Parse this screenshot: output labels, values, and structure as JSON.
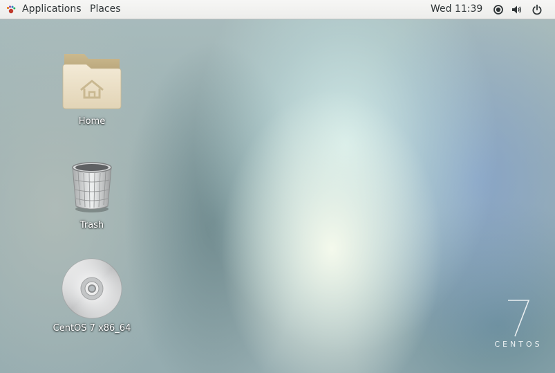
{
  "topbar": {
    "applications_label": "Applications",
    "places_label": "Places",
    "clock": "Wed 11:39"
  },
  "tray": {
    "icons": [
      "network-icon",
      "volume-icon",
      "power-icon"
    ]
  },
  "desktop_icons": [
    {
      "label": "Home",
      "icon": "home-folder-icon"
    },
    {
      "label": "Trash",
      "icon": "trash-icon"
    },
    {
      "label": "CentOS 7 x86_64",
      "icon": "optical-disc-icon"
    }
  ],
  "branding": {
    "version_numeral": "7",
    "wordmark": "CENTOS"
  },
  "colors": {
    "topbar_bg": "#ededeb",
    "folder": "#e8dcc4",
    "label_text": "#ffffff"
  }
}
